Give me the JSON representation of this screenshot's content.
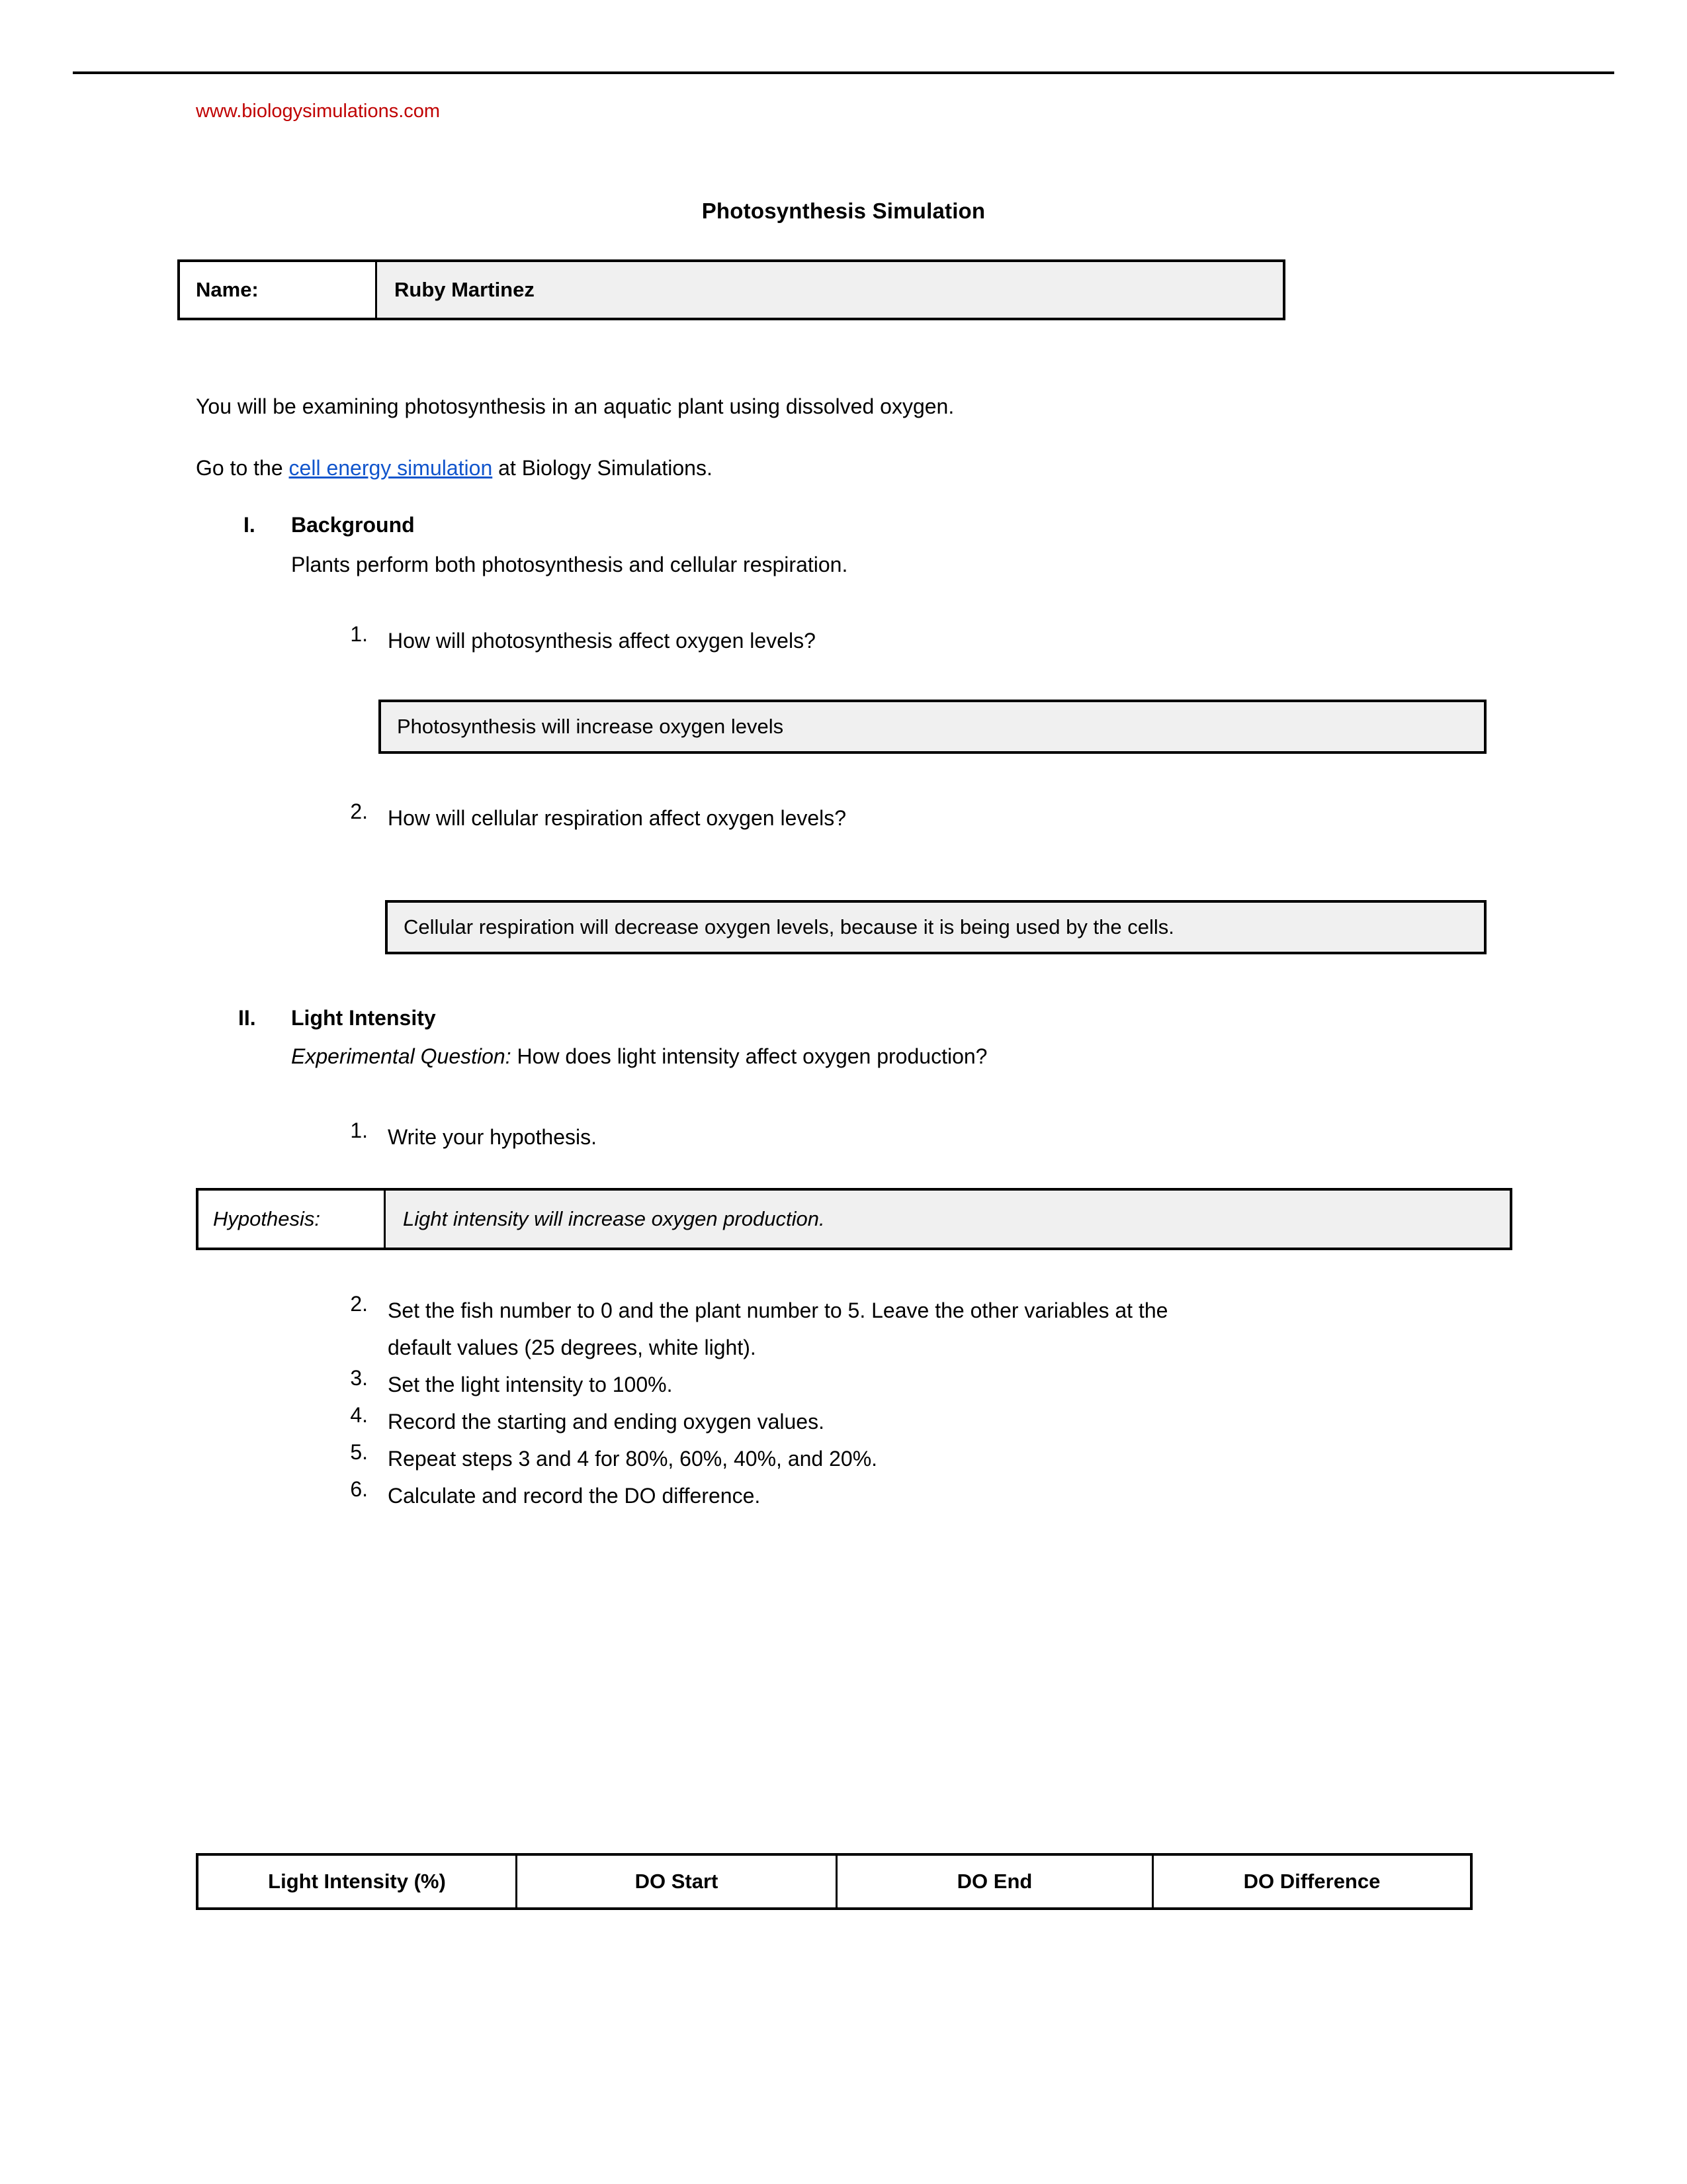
{
  "header": {
    "site_url": "www.biologysimulations.com"
  },
  "document": {
    "title": "Photosynthesis Simulation"
  },
  "name_row": {
    "label": "Name:",
    "value": "Ruby Martinez"
  },
  "intro": {
    "line1": "You will be examining photosynthesis in an aquatic plant using dissolved oxygen.",
    "line2_before": "Go to the ",
    "link_text": "cell energy simulation",
    "line2_after": " at Biology Simulations."
  },
  "section_background": {
    "numeral": "I.",
    "title": "Background",
    "description": "Plants perform both photosynthesis and cellular respiration.",
    "questions": [
      {
        "number": "1.",
        "text": "How will photosynthesis affect oxygen levels?",
        "answer": "Photosynthesis will increase oxygen levels"
      },
      {
        "number": "2.",
        "text": "How will cellular respiration affect oxygen levels?",
        "answer": "Cellular respiration will decrease oxygen levels, because it is being used by the cells."
      }
    ]
  },
  "section_light_intensity": {
    "numeral": "II.",
    "title": "Light Intensity",
    "experimental_question_label": "Experimental Question:",
    "experimental_question_text": " How does light intensity affect oxygen production?",
    "step1_number": "1.",
    "step1_text": "Write your hypothesis.",
    "hypothesis_label": "Hypothesis:",
    "hypothesis_value": "Light intensity will increase oxygen production.",
    "steps": [
      {
        "number": "2.",
        "line1": "Set the fish number to 0 and the plant number to 5. Leave the other variables at the",
        "line2": "default values (25 degrees, white light)."
      },
      {
        "number": "3.",
        "line1": "Set the light intensity to 100%.",
        "line2": ""
      },
      {
        "number": "4.",
        "line1": "Record the starting and ending oxygen values.",
        "line2": ""
      },
      {
        "number": "5.",
        "line1": "Repeat steps 3 and 4 for 80%, 60%, 40%, and 20%.",
        "line2": ""
      },
      {
        "number": "6.",
        "line1": "Calculate and record the DO difference.",
        "line2": ""
      }
    ]
  },
  "data_table": {
    "headers": [
      "Light Intensity (%)",
      "DO Start",
      "DO End",
      "DO Difference"
    ],
    "rows": []
  },
  "colors": {
    "link": "#1155CC",
    "site_url": "#C00000",
    "field_fill": "#F0F0F0",
    "border": "#000000"
  }
}
